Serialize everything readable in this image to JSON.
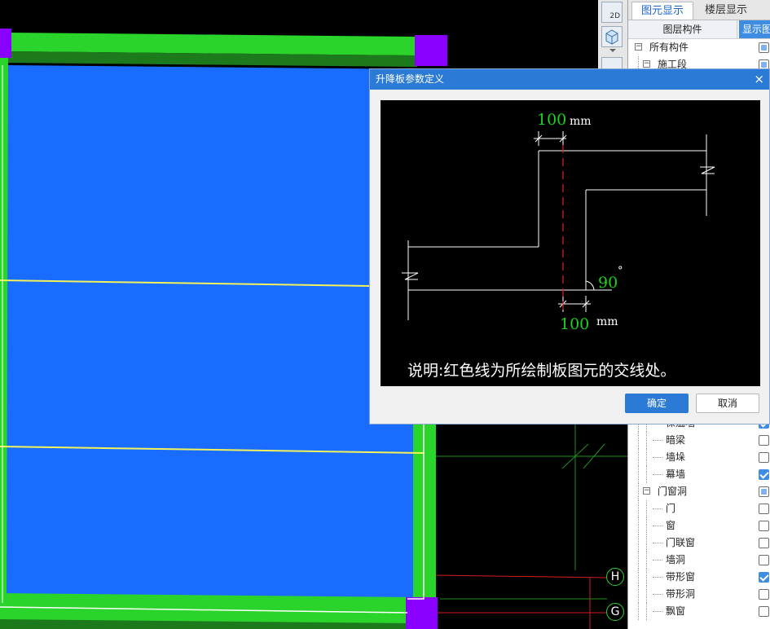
{
  "canvas": {
    "axis_labels": [
      "H",
      "G"
    ]
  },
  "view_toolbar": {
    "btn_2d_label": "2D"
  },
  "right_panel": {
    "tabs": [
      {
        "label": "图元显示",
        "active": true
      },
      {
        "label": "楼层显示",
        "active": false
      }
    ],
    "columns": {
      "name": "图层构件",
      "show": "显示图"
    },
    "tree_top": [
      {
        "label": "所有构件",
        "expander": "−",
        "checked": "partial"
      },
      {
        "label": "施工段",
        "expander": "−",
        "checked": "partial"
      }
    ],
    "tree_bottom": [
      {
        "label": "保温墙",
        "checked": "on"
      },
      {
        "label": "暗梁",
        "checked": "off"
      },
      {
        "label": "墙垛",
        "checked": "off"
      },
      {
        "label": "幕墙",
        "checked": "on"
      },
      {
        "label": "门窗洞",
        "expander": "−",
        "checked": "partial"
      },
      {
        "label": "门",
        "checked": "off"
      },
      {
        "label": "窗",
        "checked": "off"
      },
      {
        "label": "门联窗",
        "checked": "off"
      },
      {
        "label": "墙洞",
        "checked": "off"
      },
      {
        "label": "带形窗",
        "checked": "on"
      },
      {
        "label": "带形洞",
        "checked": "off"
      },
      {
        "label": "飘窗",
        "checked": "off"
      }
    ]
  },
  "dialog": {
    "title": "升降板参数定义",
    "close_symbol": "×",
    "diagram": {
      "top_offset": "100",
      "bottom_offset": "100",
      "unit": "mm",
      "angle": "90",
      "degree_symbol": "°",
      "note": "说明:红色线为所绘制板图元的交线处。"
    },
    "ok_label": "确定",
    "cancel_label": "取消"
  },
  "colors": {
    "slab_blue": "#1a6cff",
    "beam_green": "#2bd42b",
    "column_purple": "#8a00ff",
    "dialog_titlebar": "#2b7bd6",
    "dimension_green": "#19d419",
    "section_red": "#e02020"
  }
}
